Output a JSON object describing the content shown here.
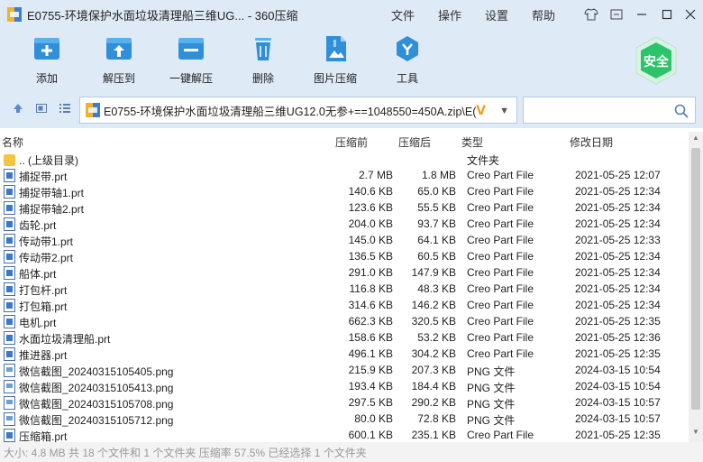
{
  "window": {
    "title": "E0755-环境保护水面垃圾清理船三维UG... - 360压缩",
    "menu": [
      "文件",
      "操作",
      "设置",
      "帮助"
    ]
  },
  "toolbar": {
    "items": [
      {
        "label": "添加",
        "icon": "add-icon",
        "color": "#2f8fd8"
      },
      {
        "label": "解压到",
        "icon": "extract-to-icon",
        "color": "#2f8fd8"
      },
      {
        "label": "一键解压",
        "icon": "one-click-extract-icon",
        "color": "#2f8fd8"
      },
      {
        "label": "删除",
        "icon": "trash-icon",
        "color": "#2f8fd8"
      },
      {
        "label": "图片压缩",
        "icon": "image-compress-icon",
        "color": "#2f8fd8"
      },
      {
        "label": "工具",
        "icon": "tools-icon",
        "color": "#2f8fd8"
      }
    ],
    "security_label": "安全",
    "security_color": "#2cc46a"
  },
  "address": {
    "path": "E0755-环境保护水面垃圾清理船三维UG12.0无参+==1048550=450A.zip\\E(",
    "search_placeholder": ""
  },
  "columns": {
    "name": "名称",
    "packed": "压缩前",
    "compressed": "压缩后",
    "type": "类型",
    "modified": "修改日期"
  },
  "files": [
    {
      "name": ".. (上级目录)",
      "size": "",
      "packed": "",
      "type": "文件夹",
      "date": "",
      "kind": "folder"
    },
    {
      "name": "捕捉带.prt",
      "size": "2.7 MB",
      "packed": "1.8 MB",
      "type": "Creo Part File",
      "date": "2021-05-25 12:07",
      "kind": "prt"
    },
    {
      "name": "捕捉带轴1.prt",
      "size": "140.6 KB",
      "packed": "65.0 KB",
      "type": "Creo Part File",
      "date": "2021-05-25 12:34",
      "kind": "prt"
    },
    {
      "name": "捕捉带轴2.prt",
      "size": "123.6 KB",
      "packed": "55.5 KB",
      "type": "Creo Part File",
      "date": "2021-05-25 12:34",
      "kind": "prt"
    },
    {
      "name": "齿轮.prt",
      "size": "204.0 KB",
      "packed": "93.7 KB",
      "type": "Creo Part File",
      "date": "2021-05-25 12:34",
      "kind": "prt"
    },
    {
      "name": "传动带1.prt",
      "size": "145.0 KB",
      "packed": "64.1 KB",
      "type": "Creo Part File",
      "date": "2021-05-25 12:33",
      "kind": "prt"
    },
    {
      "name": "传动带2.prt",
      "size": "136.5 KB",
      "packed": "60.5 KB",
      "type": "Creo Part File",
      "date": "2021-05-25 12:34",
      "kind": "prt"
    },
    {
      "name": "船体.prt",
      "size": "291.0 KB",
      "packed": "147.9 KB",
      "type": "Creo Part File",
      "date": "2021-05-25 12:34",
      "kind": "prt"
    },
    {
      "name": "打包杆.prt",
      "size": "116.8 KB",
      "packed": "48.3 KB",
      "type": "Creo Part File",
      "date": "2021-05-25 12:34",
      "kind": "prt"
    },
    {
      "name": "打包箱.prt",
      "size": "314.6 KB",
      "packed": "146.2 KB",
      "type": "Creo Part File",
      "date": "2021-05-25 12:34",
      "kind": "prt"
    },
    {
      "name": "电机.prt",
      "size": "662.3 KB",
      "packed": "320.5 KB",
      "type": "Creo Part File",
      "date": "2021-05-25 12:35",
      "kind": "prt"
    },
    {
      "name": "水面垃圾清理船.prt",
      "size": "158.6 KB",
      "packed": "53.2 KB",
      "type": "Creo Part File",
      "date": "2021-05-25 12:36",
      "kind": "prt"
    },
    {
      "name": "推进器.prt",
      "size": "496.1 KB",
      "packed": "304.2 KB",
      "type": "Creo Part File",
      "date": "2021-05-25 12:35",
      "kind": "prt"
    },
    {
      "name": "微信截图_20240315105405.png",
      "size": "215.9 KB",
      "packed": "207.3 KB",
      "type": "PNG 文件",
      "date": "2024-03-15 10:54",
      "kind": "png"
    },
    {
      "name": "微信截图_20240315105413.png",
      "size": "193.4 KB",
      "packed": "184.4 KB",
      "type": "PNG 文件",
      "date": "2024-03-15 10:54",
      "kind": "png"
    },
    {
      "name": "微信截图_20240315105708.png",
      "size": "297.5 KB",
      "packed": "290.2 KB",
      "type": "PNG 文件",
      "date": "2024-03-15 10:57",
      "kind": "png"
    },
    {
      "name": "微信截图_20240315105712.png",
      "size": "80.0 KB",
      "packed": "72.8 KB",
      "type": "PNG 文件",
      "date": "2024-03-15 10:57",
      "kind": "png"
    },
    {
      "name": "压缩箱.prt",
      "size": "600.1 KB",
      "packed": "235.1 KB",
      "type": "Creo Part File",
      "date": "2021-05-25 12:35",
      "kind": "prt"
    }
  ],
  "status": "大小: 4.8 MB 共 18 个文件和 1 个文件夹 压缩率 57.5% 已经选择 1 个文件夹"
}
